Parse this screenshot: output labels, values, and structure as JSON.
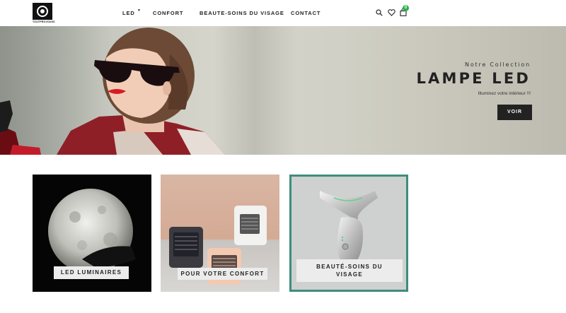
{
  "header": {
    "logo_text": "TOUTPROVOUSS",
    "nav": [
      {
        "label": "LED"
      },
      {
        "label": "CONFORT"
      },
      {
        "label": "BEAUTE-SOINS DU VISAGE"
      },
      {
        "label": "CONTACT"
      }
    ],
    "cart_count": "0"
  },
  "hero": {
    "subtitle": "Notre Collection",
    "title": "LAMPE LED",
    "description": "Illuminez votre intérieur !!!",
    "button_label": "VOIR"
  },
  "categories": [
    {
      "label": "LED LUMINAIRES"
    },
    {
      "label": "POUR VOTRE CONFORT"
    },
    {
      "label_line1": "BEAUTÉ-SOINS DU",
      "label_line2": "VISAGE"
    }
  ],
  "colors": {
    "accent_teal": "#3e8d7d",
    "cart_badge": "#2bb24c",
    "button_dark": "#222222"
  }
}
